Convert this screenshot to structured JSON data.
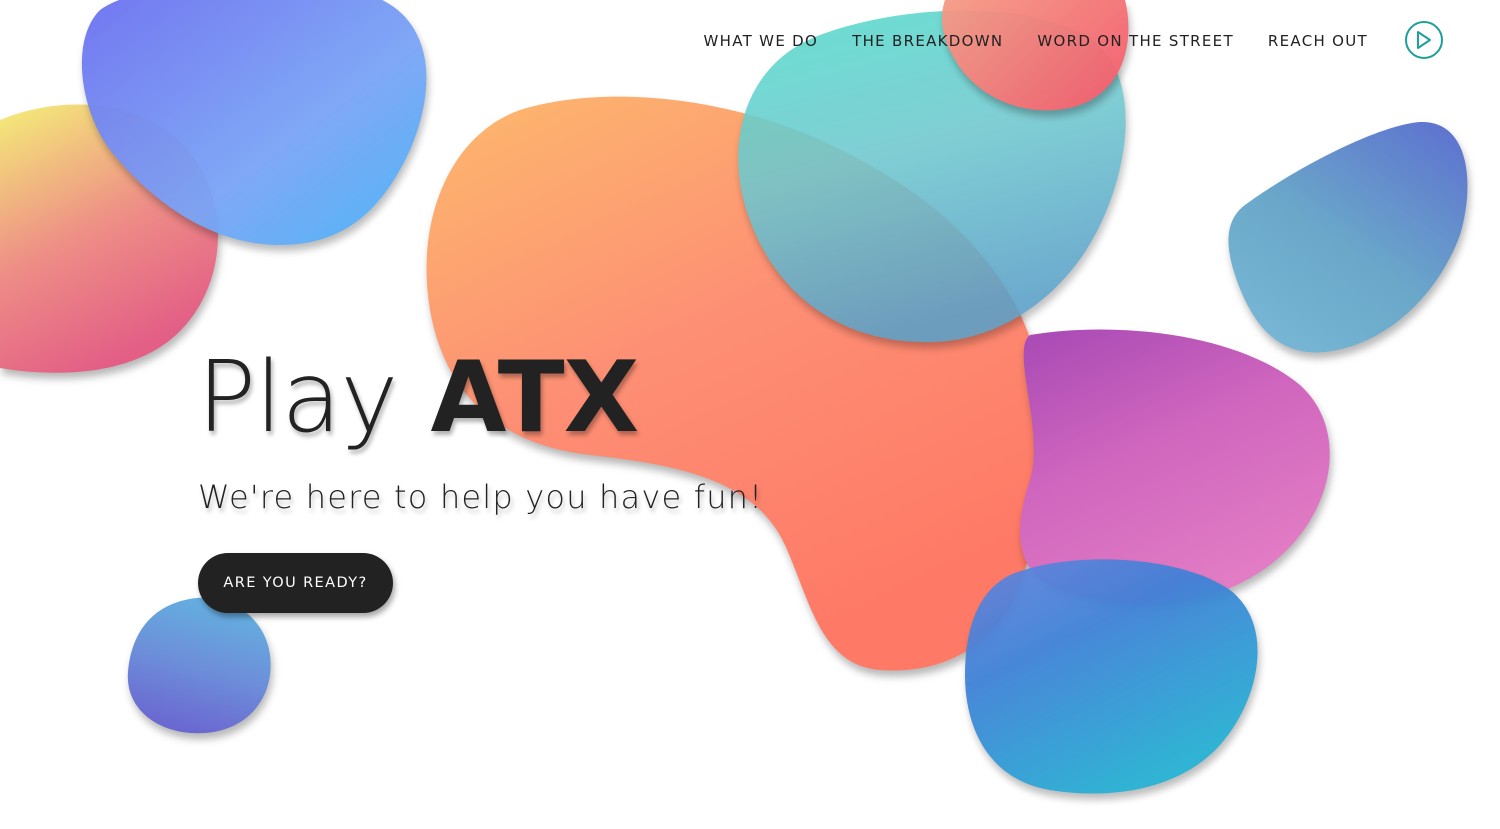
{
  "nav": {
    "items": [
      {
        "label": "WHAT WE DO"
      },
      {
        "label": "THE BREAKDOWN"
      },
      {
        "label": "WORD ON THE STREET"
      },
      {
        "label": "REACH OUT"
      }
    ],
    "play_icon": "play-circle-icon",
    "accent_color": "#1f9e9e"
  },
  "hero": {
    "title_light": "Play",
    "title_bold": "ATX",
    "subtitle": "We're here to help you have fun!",
    "cta_label": "ARE YOU READY?"
  },
  "colors": {
    "text": "#222222",
    "background": "#ffffff"
  }
}
